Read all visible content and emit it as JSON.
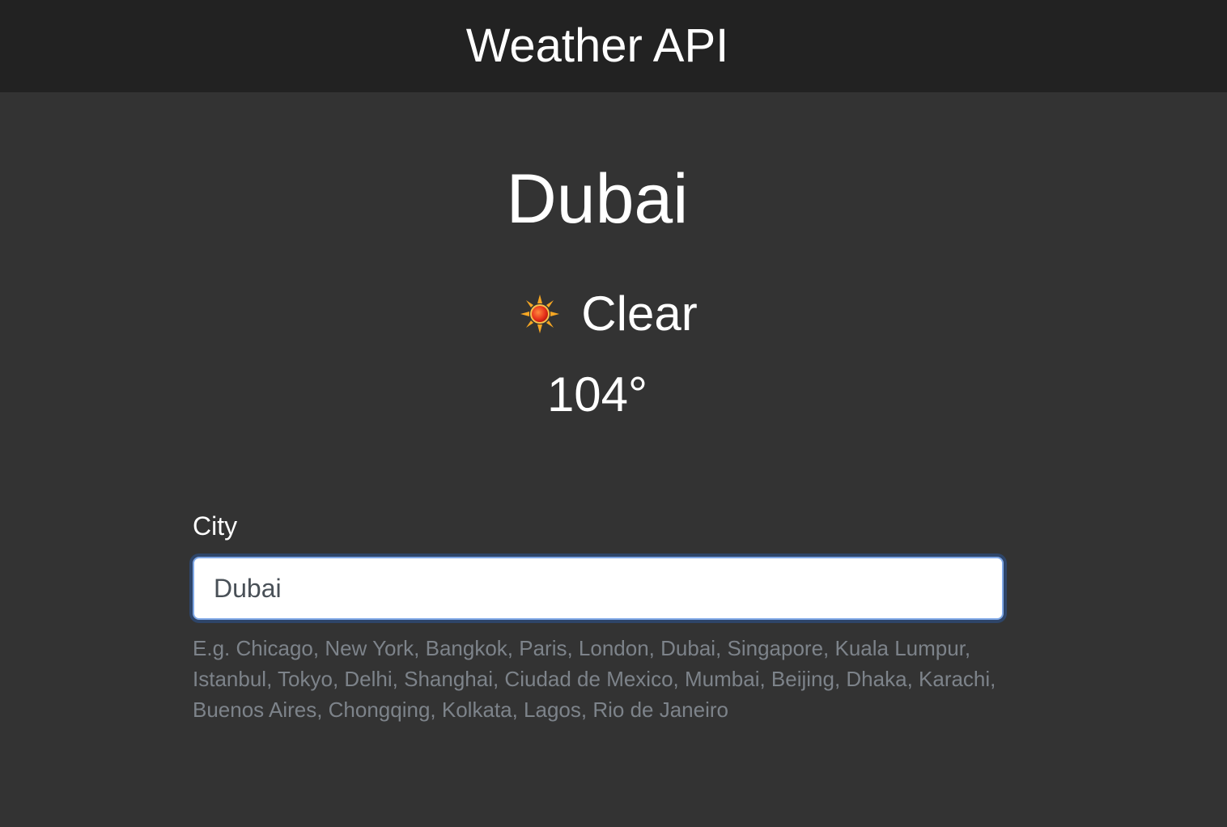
{
  "header": {
    "title": "Weather API"
  },
  "weather": {
    "city": "Dubai",
    "icon": "sun-icon",
    "condition": "Clear",
    "temperature": "104°"
  },
  "form": {
    "label": "City",
    "value": "Dubai",
    "hint": "E.g. Chicago, New York, Bangkok, Paris, London, Dubai, Singapore, Kuala Lumpur, Istanbul, Tokyo, Delhi, Shanghai, Ciudad de Mexico, Mumbai, Beijing, Dhaka, Karachi, Buenos Aires, Chongqing, Kolkata, Lagos, Rio de Janeiro"
  },
  "colors": {
    "header_bg": "#222222",
    "page_bg": "#333333",
    "focus_ring": "#80a8e6",
    "hint_text": "#7d838a"
  }
}
